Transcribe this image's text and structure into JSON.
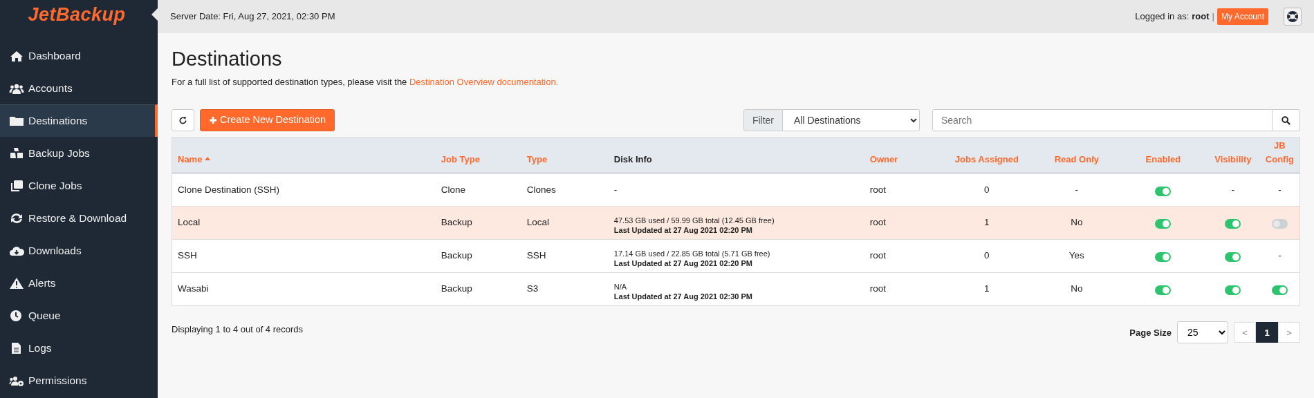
{
  "brand": {
    "logo": "JetBackup"
  },
  "sidebar": {
    "items": [
      {
        "label": "Dashboard",
        "selected": false
      },
      {
        "label": "Accounts",
        "selected": false
      },
      {
        "label": "Destinations",
        "selected": true
      },
      {
        "label": "Backup Jobs",
        "selected": false
      },
      {
        "label": "Clone Jobs",
        "selected": false
      },
      {
        "label": "Restore & Download",
        "selected": false
      },
      {
        "label": "Downloads",
        "selected": false
      },
      {
        "label": "Alerts",
        "selected": false
      },
      {
        "label": "Queue",
        "selected": false
      },
      {
        "label": "Logs",
        "selected": false
      },
      {
        "label": "Permissions",
        "selected": false
      }
    ]
  },
  "topbar": {
    "server_date": "Server Date: Fri, Aug 27, 2021, 02:30 PM",
    "logged_in_label": "Logged in as:",
    "user": "root",
    "separator": "|",
    "account_button": "My Account"
  },
  "page": {
    "title": "Destinations",
    "intro": "For a full list of supported destination types, please visit the ",
    "intro_link": "Destination Overview documentation."
  },
  "toolbar": {
    "create_button": "Create New Destination",
    "filter_label": "Filter",
    "filter_value": "All Destinations",
    "search_placeholder": "Search"
  },
  "table": {
    "columns": [
      {
        "label": "Name",
        "sortable": true,
        "sorted": true
      },
      {
        "label": "Job Type",
        "sortable": true,
        "sorted": false
      },
      {
        "label": "Type",
        "sortable": true,
        "sorted": false
      },
      {
        "label": "Disk Info",
        "sortable": false,
        "sorted": false
      },
      {
        "label": "Owner",
        "sortable": true,
        "sorted": false
      },
      {
        "label": "Jobs Assigned",
        "sortable": true,
        "sorted": false
      },
      {
        "label": "Read Only",
        "sortable": true,
        "sorted": false
      },
      {
        "label": "Enabled",
        "sortable": true,
        "sorted": false
      },
      {
        "label": "Visibility",
        "sortable": true,
        "sorted": false
      },
      {
        "label": "JB Config",
        "sortable": true,
        "sorted": false
      }
    ],
    "rows": [
      {
        "selected": false,
        "cells": [
          {
            "kind": "text",
            "text": "Clone Destination (SSH)"
          },
          {
            "kind": "text",
            "text": "Clone"
          },
          {
            "kind": "text",
            "text": "Clones"
          },
          {
            "kind": "text",
            "text": "-"
          },
          {
            "kind": "text",
            "text": "root"
          },
          {
            "kind": "text",
            "text": "0"
          },
          {
            "kind": "text",
            "text": "-"
          },
          {
            "kind": "toggle",
            "on": true
          },
          {
            "kind": "text",
            "text": "-"
          },
          {
            "kind": "text",
            "text": "-"
          }
        ]
      },
      {
        "selected": true,
        "cells": [
          {
            "kind": "text",
            "text": "Local"
          },
          {
            "kind": "text",
            "text": "Backup"
          },
          {
            "kind": "text",
            "text": "Local"
          },
          {
            "kind": "disk",
            "text": "47.53 GB used / 59.99 GB total (12.45 GB free)",
            "updated": "Last Updated at 27 Aug 2021 02:20 PM"
          },
          {
            "kind": "text",
            "text": "root"
          },
          {
            "kind": "text",
            "text": "1"
          },
          {
            "kind": "text",
            "text": "No"
          },
          {
            "kind": "toggle",
            "on": true
          },
          {
            "kind": "toggle",
            "on": true
          },
          {
            "kind": "toggle",
            "on": false
          }
        ]
      },
      {
        "selected": false,
        "cells": [
          {
            "kind": "text",
            "text": "SSH"
          },
          {
            "kind": "text",
            "text": "Backup"
          },
          {
            "kind": "text",
            "text": "SSH"
          },
          {
            "kind": "disk",
            "text": "17.14 GB used / 22.85 GB total (5.71 GB free)",
            "updated": "Last Updated at 27 Aug 2021 02:20 PM"
          },
          {
            "kind": "text",
            "text": "root"
          },
          {
            "kind": "text",
            "text": "0"
          },
          {
            "kind": "text",
            "text": "Yes"
          },
          {
            "kind": "toggle",
            "on": true
          },
          {
            "kind": "toggle",
            "on": true
          },
          {
            "kind": "text",
            "text": "-"
          }
        ]
      },
      {
        "selected": false,
        "cells": [
          {
            "kind": "text",
            "text": "Wasabi"
          },
          {
            "kind": "text",
            "text": "Backup"
          },
          {
            "kind": "text",
            "text": "S3"
          },
          {
            "kind": "disk",
            "text": "N/A",
            "updated": "Last Updated at 27 Aug 2021 02:30 PM"
          },
          {
            "kind": "text",
            "text": "root"
          },
          {
            "kind": "text",
            "text": "1"
          },
          {
            "kind": "text",
            "text": "No"
          },
          {
            "kind": "toggle",
            "on": true
          },
          {
            "kind": "toggle",
            "on": true
          },
          {
            "kind": "toggle",
            "on": true
          }
        ]
      }
    ]
  },
  "footer": {
    "summary": "Displaying 1 to 4 out of 4 records",
    "page_size_label": "Page Size",
    "page_size": "25",
    "pages": [
      {
        "label": "<",
        "selected": false
      },
      {
        "label": "1",
        "selected": true
      },
      {
        "label": ">",
        "selected": false
      }
    ]
  }
}
